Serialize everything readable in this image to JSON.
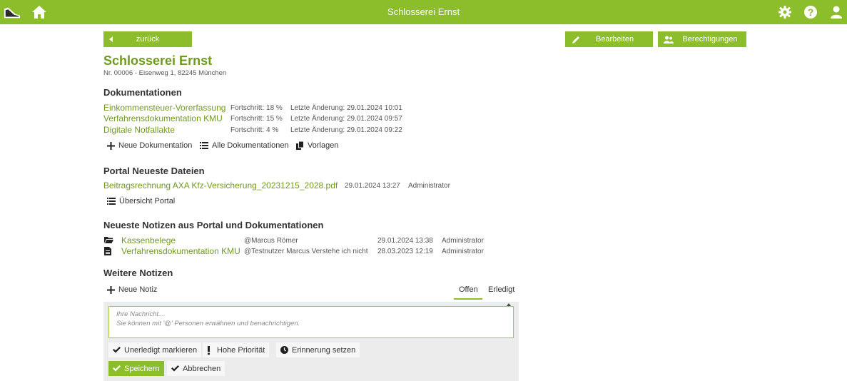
{
  "header": {
    "title": "Schlosserei Ernst"
  },
  "nav": {
    "back_label": "zurück",
    "edit_label": "Bearbeiten",
    "permissions_label": "Berechtigungen"
  },
  "client": {
    "name": "Schlosserei Ernst",
    "subtitle": "Nr. 00006 - Eisenweg 1, 82245 München"
  },
  "docs": {
    "heading": "Dokumentationen",
    "items": [
      {
        "name": "Einkommensteuer-Vorerfassung",
        "progress": "Fortschritt: 18 %",
        "changed": "Letzte Änderung: 29.01.2024 10:01"
      },
      {
        "name": "Verfahrensdokumentation KMU",
        "progress": "Fortschritt: 15 %",
        "changed": "Letzte Änderung: 29.01.2024 09:57"
      },
      {
        "name": "Digitale Notfallakte",
        "progress": "Fortschritt: 4 %",
        "changed": "Letzte Änderung: 29.01.2024 09:22"
      }
    ],
    "actions": {
      "new": "Neue Dokumentation",
      "all": "Alle Dokumentationen",
      "templates": "Vorlagen"
    }
  },
  "portal": {
    "heading": "Portal Neueste Dateien",
    "files": [
      {
        "name": "Beitragsrechnung AXA Kfz-Versicherung_20231215_2028.pdf",
        "date": "29.01.2024 13:27",
        "user": "Administrator"
      }
    ],
    "overview_label": "Übersicht Portal"
  },
  "latest_notes": {
    "heading": "Neueste Notizen aus Portal und Dokumentationen",
    "items": [
      {
        "icon": "folder-icon",
        "name": "Kassenbelege",
        "text": "@Marcus Römer",
        "date": "29.01.2024 13:38",
        "user": "Administrator"
      },
      {
        "icon": "document-icon",
        "name": "Verfahrensdokumentation KMU",
        "text": "@Testnutzer Marcus Verstehe ich nicht",
        "date": "28.03.2023 12:19",
        "user": "Administrator"
      }
    ]
  },
  "more_notes": {
    "heading": "Weitere Notizen",
    "new_label": "Neue Notiz",
    "tabs": {
      "open": "Offen",
      "done": "Erledigt"
    },
    "editor": {
      "placeholder_line1": "Ihre Nachricht...",
      "placeholder_line2": "Sie können mit '@' Personen erwähnen und benachrichtigen."
    },
    "buttons": {
      "mark_undone": "Unerledigt markieren",
      "high_priority": "Hohe Priorität",
      "reminder": "Erinnerung setzen",
      "save": "Speichern",
      "cancel": "Abbrechen"
    }
  },
  "colors": {
    "brand": "#8cbd2b",
    "link": "#6f9a1f"
  }
}
